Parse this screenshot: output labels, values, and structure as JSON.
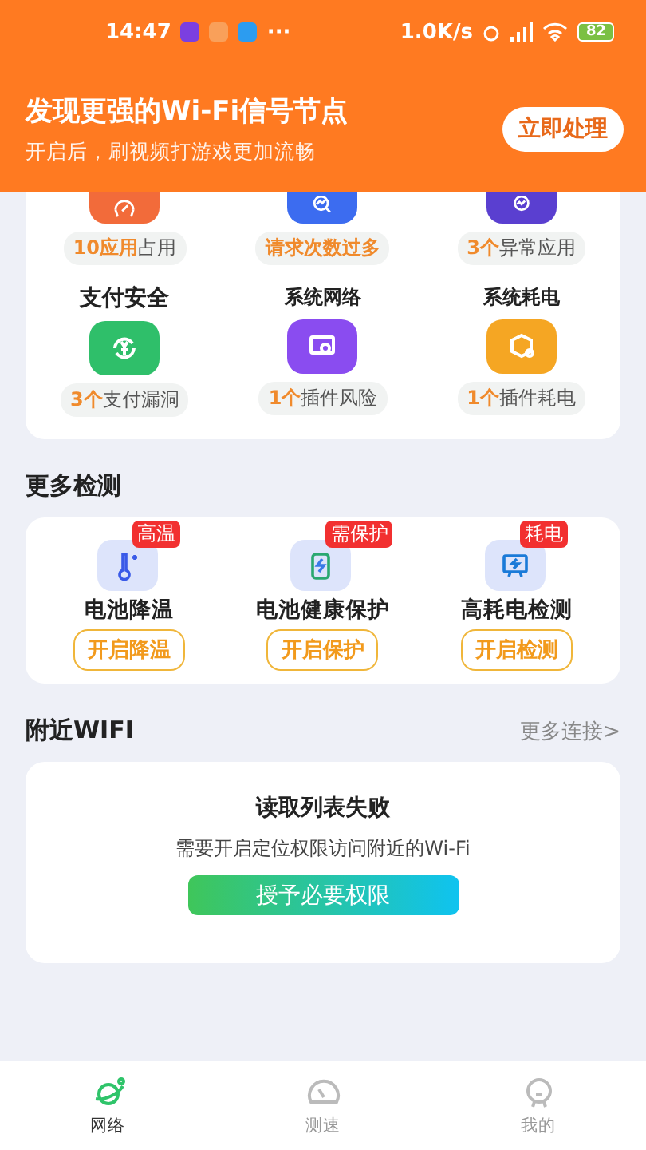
{
  "status_bar": {
    "time": "14:47",
    "more": "···",
    "speed": "1.0K/s",
    "battery": "82"
  },
  "banner": {
    "title": "发现更强的Wi-Fi信号节点",
    "subtitle": "开启后，刷视频打游戏更加流畅",
    "button": "立即处理"
  },
  "checks": [
    {
      "color": "#f26b3a",
      "count": "10应用",
      "rest": "占用"
    },
    {
      "color": "#3c6cf0",
      "count": "请求次数过多"
    },
    {
      "color": "#5a3fd0",
      "count": "3个",
      "rest": "异常应用"
    },
    {
      "title": "支付安全",
      "color": "#2fbf6a",
      "count": "3个",
      "rest": "支付漏洞"
    },
    {
      "title": "系统网络",
      "color": "#8a4cf0",
      "count": "1个",
      "rest": "插件风险"
    },
    {
      "title": "系统耗电",
      "color": "#f5a623",
      "count": "1个",
      "rest": "插件耗电"
    }
  ],
  "more_section": {
    "title": "更多检测",
    "items": [
      {
        "badge": "高温",
        "name": "电池降温",
        "button": "开启降温"
      },
      {
        "badge": "需保护",
        "name": "电池健康保护",
        "button": "开启保护"
      },
      {
        "badge": "耗电",
        "name": "高耗电检测",
        "button": "开启检测"
      }
    ]
  },
  "nearby": {
    "title": "附近WIFI",
    "link": "更多连接>",
    "error_title": "读取列表失败",
    "error_text": "需要开启定位权限访问附近的Wi-Fi",
    "button": "授予必要权限"
  },
  "tabs": [
    {
      "label": "网络",
      "selected": true
    },
    {
      "label": "测速",
      "selected": false
    },
    {
      "label": "我的",
      "selected": false
    }
  ]
}
